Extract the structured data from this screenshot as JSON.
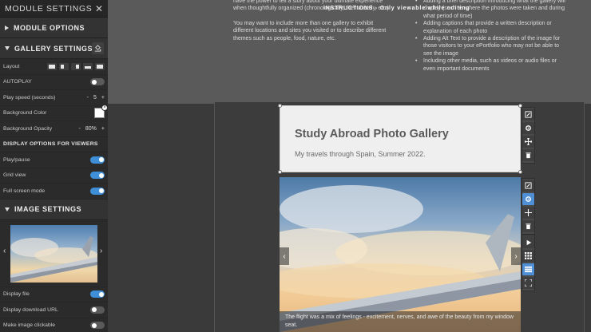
{
  "panel": {
    "title": "MODULE SETTINGS",
    "close_glyph": "✕",
    "module_options": "MODULE OPTIONS",
    "gallery_settings": "GALLERY SETTINGS",
    "layout_label": "Layout",
    "autoplay_label": "AUTOPLAY",
    "play_speed_label": "Play speed (seconds)",
    "play_speed_minus": "-",
    "play_speed_value": "5",
    "play_speed_plus": "+",
    "bg_color_label": "Background Color",
    "bg_opacity_label": "Background Opacity",
    "bg_opacity_minus": "-",
    "bg_opacity_value": "80%",
    "bg_opacity_plus": "+",
    "display_options_label": "DISPLAY OPTIONS FOR VIEWERS",
    "playpause_label": "Play/pause",
    "gridview_label": "Grid view",
    "fullscreen_label": "Full screen mode",
    "image_settings": "IMAGE SETTINGS",
    "thumb_prev": "‹",
    "thumb_next": "›",
    "display_file_label": "Display file",
    "display_download_label": "Display download URL",
    "make_clickable_label": "Make image clickable",
    "toggles": {
      "autoplay": false,
      "playpause": true,
      "gridview": true,
      "fullscreen": true,
      "display_file": true,
      "display_download": false,
      "make_clickable": false
    }
  },
  "instructions": {
    "title": "INSTRUCTIONS - Only viewable while editing",
    "left_para1": "have the power to tell a story about your ultimate experience when thoughtfully organized (chronologically, thematically, etc.).",
    "left_para2": "You may want to include more than one gallery to exhibit different locations and sites you visited or to describe different themes such as people, food, nature, etc.",
    "right_items": [
      "Adding a brief description introducing what the gallery will display (such as where the photos were taken and during what period of time)",
      "Adding captions that provide a written description or explanation of each photo",
      "Adding Alt Text to provide a description of the image for those visitors to your ePortfolio who may not be able to see the image",
      "Including other media, such as videos or audio files or even important documents"
    ]
  },
  "title_card": {
    "title": "Study Abroad Photo Gallery",
    "subtitle": "My travels through Spain, Summer 2022."
  },
  "gallery": {
    "prev": "‹",
    "next": "›",
    "caption": "The flight was a mix of feelings - excitement, nerves, and awe of the beauty from my window seat."
  }
}
